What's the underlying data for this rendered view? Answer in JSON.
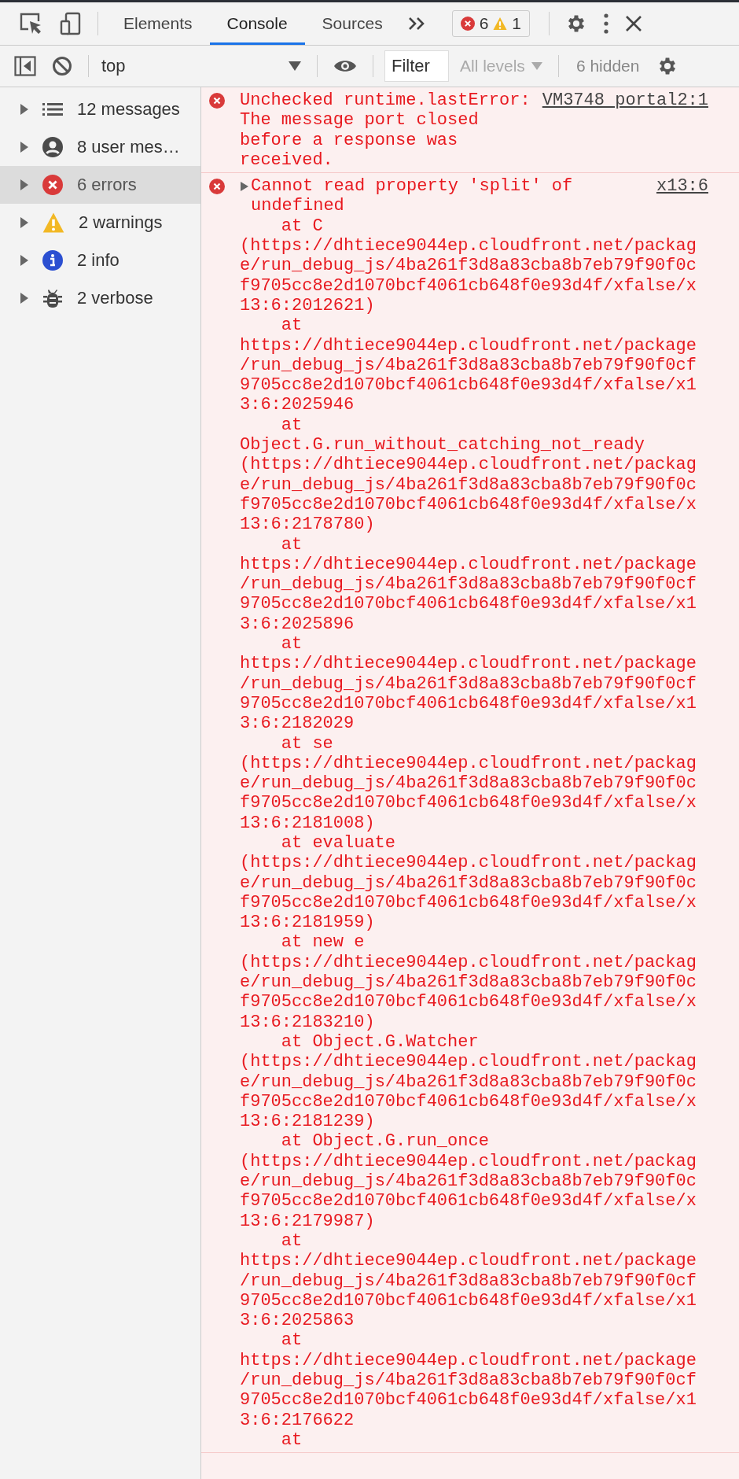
{
  "main_tabs": [
    {
      "label": "Elements",
      "selected": false
    },
    {
      "label": "Console",
      "selected": true
    },
    {
      "label": "Sources",
      "selected": false
    }
  ],
  "issue_counts": {
    "errors": "6",
    "warnings": "1"
  },
  "console_toolbar": {
    "context": "top",
    "filter": {
      "placeholder": "Filter"
    },
    "levels": {
      "label": "All levels",
      "disabled": true
    },
    "hidden_count": "6 hidden"
  },
  "sidebar": {
    "items": [
      {
        "kind": "list",
        "label": "12 messages",
        "selected": false
      },
      {
        "kind": "user",
        "label": "8 user mes…",
        "selected": false
      },
      {
        "kind": "error",
        "label": "6 errors",
        "selected": true
      },
      {
        "kind": "warning",
        "label": "2 warnings",
        "selected": false
      },
      {
        "kind": "info",
        "label": "2 info",
        "selected": false
      },
      {
        "kind": "verbose",
        "label": "2 verbose",
        "selected": false
      }
    ]
  },
  "messages": [
    {
      "kind": "error",
      "text": "Unchecked runtime.lastError: The message port closed before a response was received.",
      "source": "VM3748 portal2:1"
    },
    {
      "kind": "error",
      "expanded": false,
      "text": "Cannot read property 'split' of undefined",
      "source": "x13:6",
      "stack": [
        "at C (https://dhtiece9044ep.cloudfront.net/package/run_debug_js/4ba261f3d8a83cba8b7eb79f90f0cf9705cc8e2d1070bcf4061cb648f0e93d4f/xfalse/x13:6:2012621)",
        "at https://dhtiece9044ep.cloudfront.net/package/run_debug_js/4ba261f3d8a83cba8b7eb79f90f0cf9705cc8e2d1070bcf4061cb648f0e93d4f/xfalse/x13:6:2025946",
        "at Object.G.run_without_catching_not_ready (https://dhtiece9044ep.cloudfront.net/package/run_debug_js/4ba261f3d8a83cba8b7eb79f90f0cf9705cc8e2d1070bcf4061cb648f0e93d4f/xfalse/x13:6:2178780)",
        "at https://dhtiece9044ep.cloudfront.net/package/run_debug_js/4ba261f3d8a83cba8b7eb79f90f0cf9705cc8e2d1070bcf4061cb648f0e93d4f/xfalse/x13:6:2025896",
        "at https://dhtiece9044ep.cloudfront.net/package/run_debug_js/4ba261f3d8a83cba8b7eb79f90f0cf9705cc8e2d1070bcf4061cb648f0e93d4f/xfalse/x13:6:2182029",
        "at se (https://dhtiece9044ep.cloudfront.net/package/run_debug_js/4ba261f3d8a83cba8b7eb79f90f0cf9705cc8e2d1070bcf4061cb648f0e93d4f/xfalse/x13:6:2181008)",
        "at evaluate (https://dhtiece9044ep.cloudfront.net/package/run_debug_js/4ba261f3d8a83cba8b7eb79f90f0cf9705cc8e2d1070bcf4061cb648f0e93d4f/xfalse/x13:6:2181959)",
        "at new e (https://dhtiece9044ep.cloudfront.net/package/run_debug_js/4ba261f3d8a83cba8b7eb79f90f0cf9705cc8e2d1070bcf4061cb648f0e93d4f/xfalse/x13:6:2183210)",
        "at Object.G.Watcher (https://dhtiece9044ep.cloudfront.net/package/run_debug_js/4ba261f3d8a83cba8b7eb79f90f0cf9705cc8e2d1070bcf4061cb648f0e93d4f/xfalse/x13:6:2181239)",
        "at Object.G.run_once (https://dhtiece9044ep.cloudfront.net/package/run_debug_js/4ba261f3d8a83cba8b7eb79f90f0cf9705cc8e2d1070bcf4061cb648f0e93d4f/xfalse/x13:6:2179987)",
        "at https://dhtiece9044ep.cloudfront.net/package/run_debug_js/4ba261f3d8a83cba8b7eb79f90f0cf9705cc8e2d1070bcf4061cb648f0e93d4f/xfalse/x13:6:2025863",
        "at https://dhtiece9044ep.cloudfront.net/package/run_debug_js/4ba261f3d8a83cba8b7eb79f90f0cf9705cc8e2d1070bcf4061cb648f0e93d4f/xfalse/x13:6:2176622",
        "at"
      ]
    }
  ]
}
